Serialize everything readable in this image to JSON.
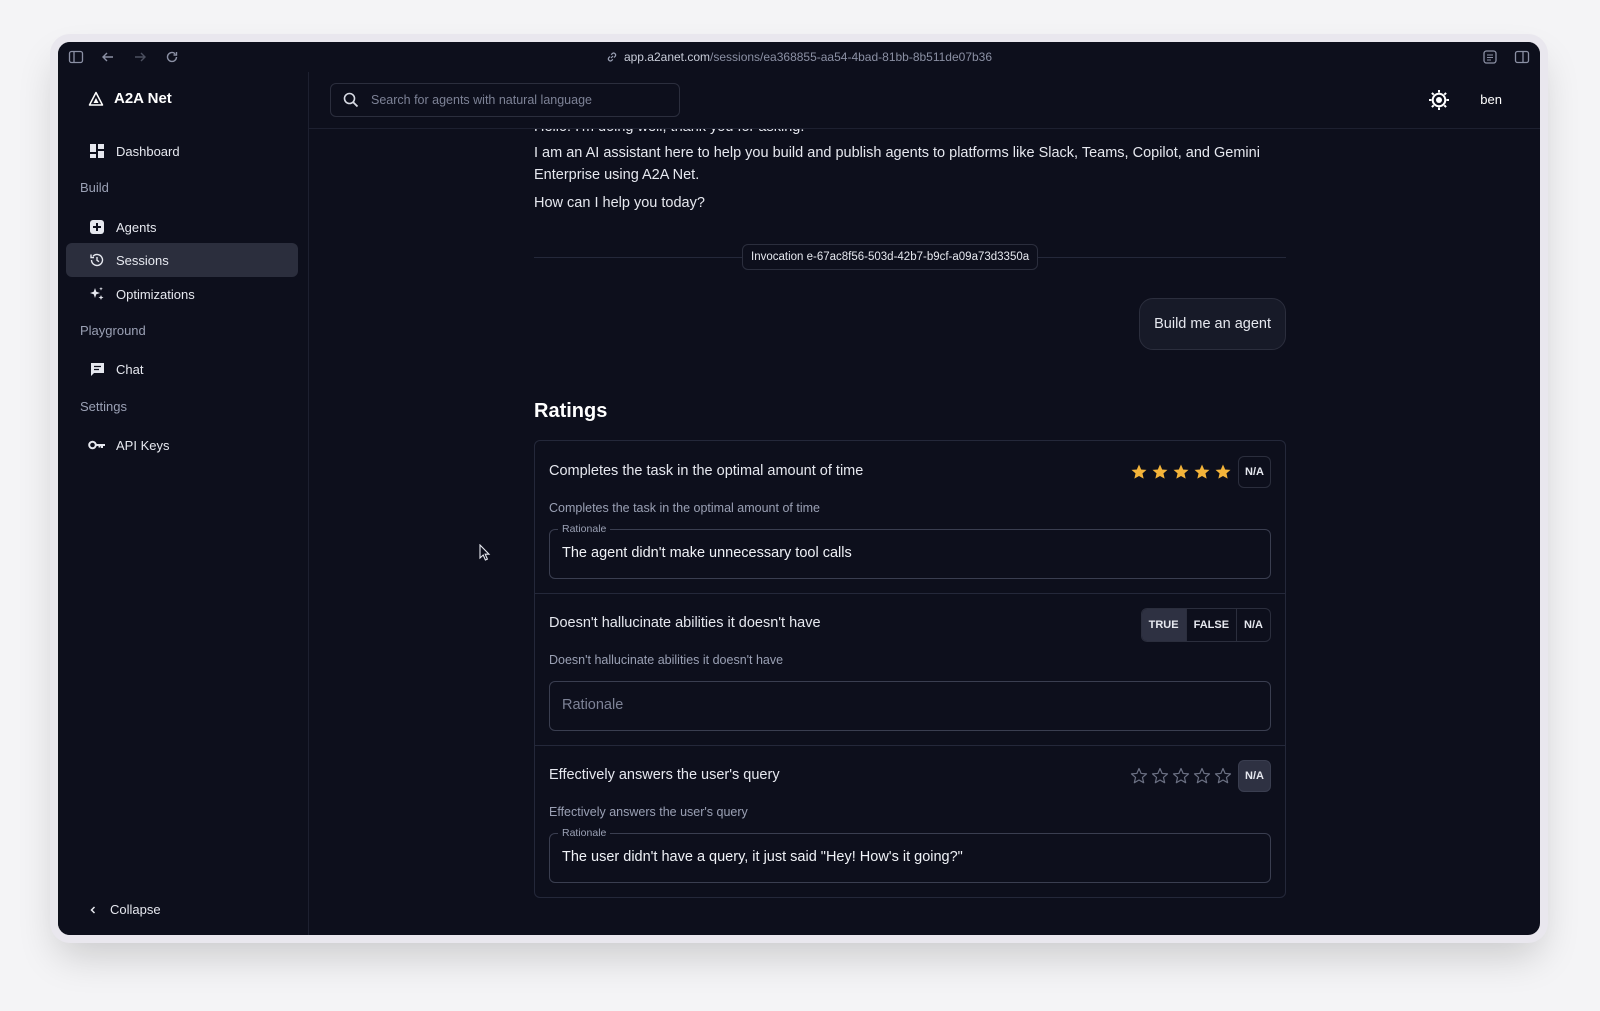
{
  "browser": {
    "url_host": "app.a2anet.com",
    "url_path": "/sessions/ea368855-aa54-4bad-81bb-8b511de07b36"
  },
  "app": {
    "name": "A2A Net"
  },
  "sidebar": {
    "dashboard": "Dashboard",
    "sections": {
      "build": "Build",
      "playground": "Playground",
      "settings": "Settings"
    },
    "agents": "Agents",
    "sessions": "Sessions",
    "optimizations": "Optimizations",
    "chat": "Chat",
    "api_keys": "API Keys",
    "collapse": "Collapse"
  },
  "topbar": {
    "search_placeholder": "Search for agents with natural language",
    "user": "ben"
  },
  "conversation": {
    "partial_line": "Hello! I'm doing well, thank you for asking.",
    "paragraph": "I am an AI assistant here to help you build and publish agents to platforms like Slack, Teams, Copilot, and Gemini Enterprise using A2A Net.",
    "question": "How can I help you today?",
    "invocation": "Invocation e-67ac8f56-503d-42b7-b9cf-a09a73d3350a",
    "user_message": "Build me an agent"
  },
  "ratings": {
    "title": "Ratings",
    "items": [
      {
        "title": "Completes the task in the optimal amount of time",
        "description": "Completes the task in the optimal amount of time",
        "type": "stars",
        "stars": 5,
        "na_label": "N/A",
        "rationale_label": "Rationale",
        "rationale": "The agent didn't make unnecessary tool calls"
      },
      {
        "title": "Doesn't hallucinate abilities it doesn't have",
        "description": "Doesn't hallucinate abilities it doesn't have",
        "type": "boolean",
        "options": [
          "TRUE",
          "FALSE",
          "N/A"
        ],
        "selected": "TRUE",
        "rationale_placeholder": "Rationale"
      },
      {
        "title": "Effectively answers the user's query",
        "description": "Effectively answers the user's query",
        "type": "stars",
        "stars": 0,
        "na_label": "N/A",
        "na_selected": true,
        "rationale_label": "Rationale",
        "rationale": "The user didn't have a query, it just said \"Hey! How's it going?\""
      }
    ]
  },
  "colors": {
    "background": "#0d0f1c",
    "star_filled": "#f4b43a",
    "star_empty": "#6b7083"
  }
}
